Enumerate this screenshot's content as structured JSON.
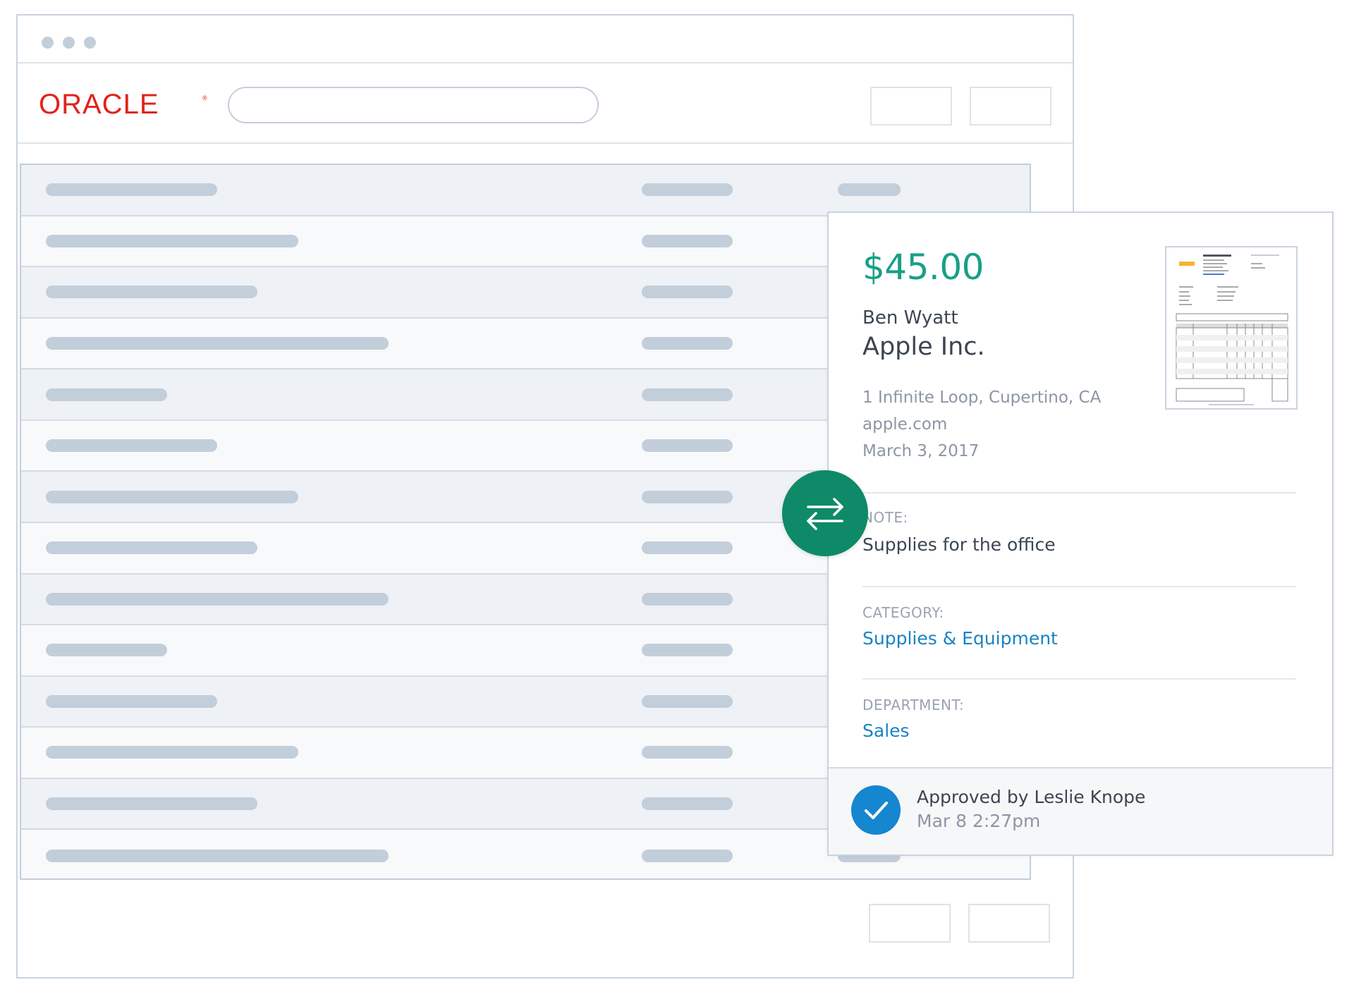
{
  "window": {
    "controls": [
      "dot",
      "dot",
      "dot"
    ],
    "header": {
      "logo_text": "ORACLE",
      "search_placeholder": "",
      "buttons": [
        "",
        ""
      ]
    }
  },
  "table": {
    "rows": 14,
    "row_placeholder_widths_pct": [
      17,
      25,
      21,
      34,
      12,
      17,
      25,
      21,
      34,
      12,
      17,
      25,
      21,
      34
    ]
  },
  "footer": {
    "buttons": [
      "",
      ""
    ]
  },
  "expense": {
    "amount": "$45.00",
    "person": "Ben Wyatt",
    "company": "Apple Inc.",
    "address": "1 Infinite Loop, Cupertino, CA",
    "website": "apple.com",
    "date": "March 3, 2017",
    "note_label": "NOTE:",
    "note_value": "Supplies for the office",
    "category_label": "CATEGORY:",
    "category_value": "Supplies & Equipment",
    "department_label": "DEPARTMENT:",
    "department_value": "Sales",
    "approval": {
      "text": "Approved by Leslie Knope",
      "time": "Mar 8 2:27pm",
      "icon": "check-icon"
    },
    "receipt_icon": "receipt-thumbnail"
  },
  "sync_icon": "swap-arrows-icon",
  "colors": {
    "amount": "#17a086",
    "link": "#1a82c4",
    "sync_button": "#0e8a68",
    "approved": "#1586d0",
    "oracle_red": "#e2231a"
  }
}
